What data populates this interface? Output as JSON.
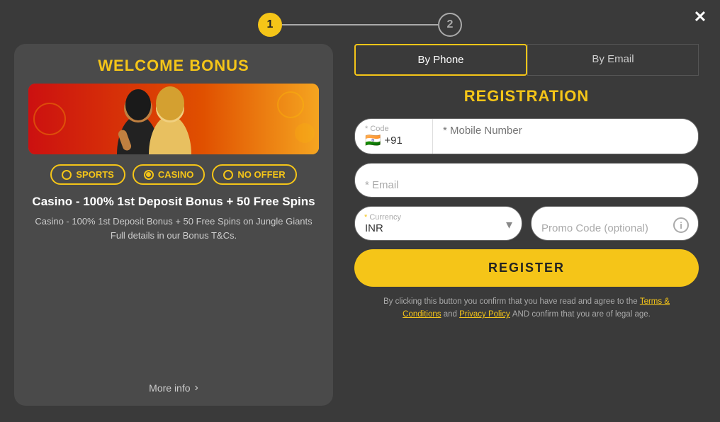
{
  "close_button": "✕",
  "steps": {
    "step1": {
      "label": "1",
      "state": "active"
    },
    "step2": {
      "label": "2",
      "state": "inactive"
    }
  },
  "left_panel": {
    "welcome_bonus_title": "WELCOME BONUS",
    "offer_tabs": [
      {
        "id": "sports",
        "label": "SPORTS",
        "selected": false
      },
      {
        "id": "casino",
        "label": "CASINO",
        "selected": true
      },
      {
        "id": "no_offer",
        "label": "NO OFFER",
        "selected": false
      }
    ],
    "bonus_title": "Casino - 100% 1st Deposit Bonus + 50 Free Spins",
    "bonus_description": "Casino - 100% 1st Deposit Bonus + 50 Free Spins on Jungle Giants\nFull details in our Bonus T&Cs.",
    "more_info_label": "More info",
    "more_info_arrow": "›"
  },
  "right_panel": {
    "tabs": [
      {
        "id": "by_phone",
        "label": "By Phone",
        "active": true
      },
      {
        "id": "by_email",
        "label": "By Email",
        "active": false
      }
    ],
    "registration_title": "REGISTRATION",
    "form": {
      "code_label": "* Code",
      "code_value": "🇮🇳 +91",
      "mobile_placeholder": "* Mobile Number",
      "email_placeholder": "* Email",
      "currency_label": "* Currency",
      "currency_value": "INR",
      "promo_placeholder": "Promo Code (optional)",
      "register_button": "REGISTER",
      "terms_line1": "By clicking this button you confirm that you have read",
      "terms_line2": "and agree to the",
      "terms_link1": "Terms & Conditions",
      "terms_and": "and",
      "terms_link2": "Privacy Policy",
      "terms_line3": "AND confirm that you are of legal age."
    }
  }
}
